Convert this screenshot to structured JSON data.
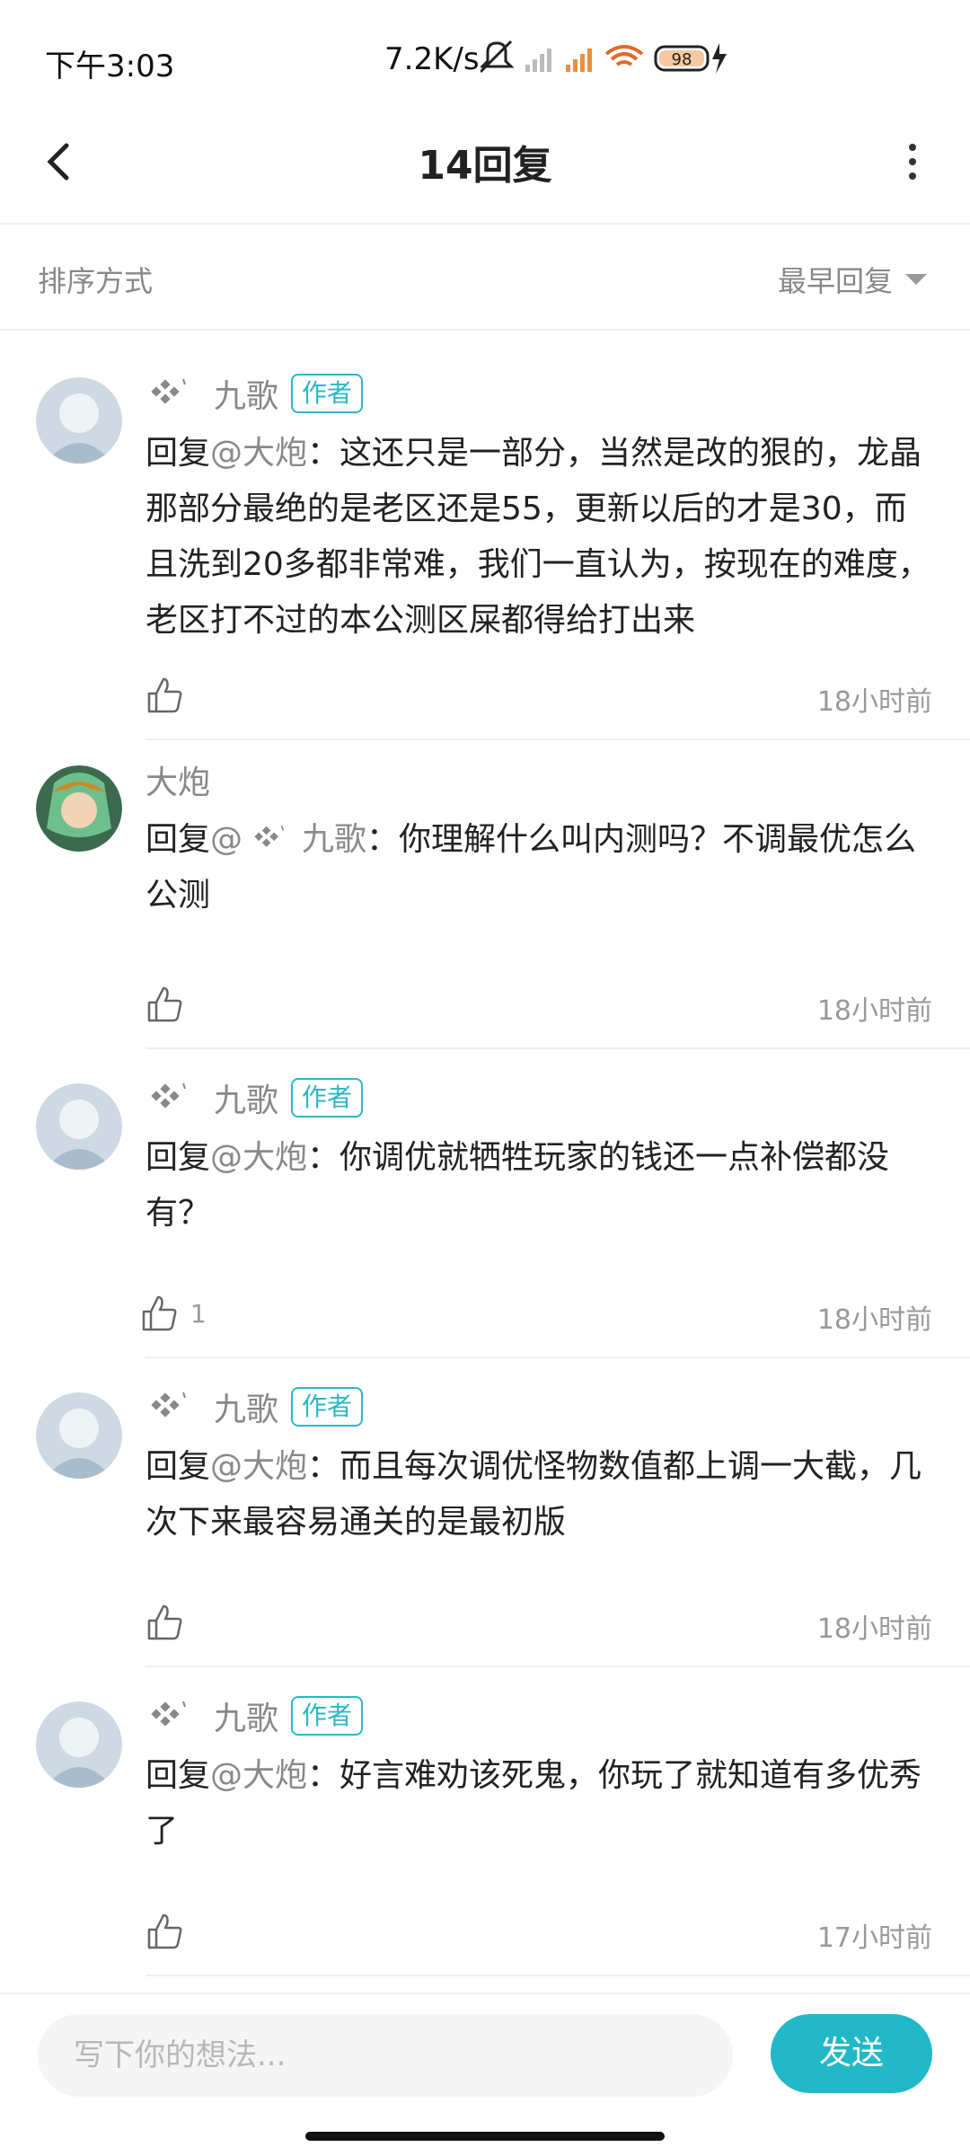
{
  "status_bar": {
    "time": "下午3:03",
    "network_speed": "7.2K/s",
    "battery": "98"
  },
  "header": {
    "title": "14回复"
  },
  "sort": {
    "label": "排序方式",
    "selected": "最早回复"
  },
  "comments": [
    {
      "author": "九歌",
      "badge": "作者",
      "reply_prefix": "回复",
      "mention": "@大炮",
      "text": "：这还只是一部分，当然是改的狠的，龙晶那部分最绝的是老区还是55，更新以后的才是30，而且洗到20多都非常难，我们一直认为，按现在的难度，老区打不过的本公测区屎都得给打出来",
      "likes": "",
      "time": "18小时前"
    },
    {
      "author": "大炮",
      "badge": "",
      "reply_prefix": "回复",
      "mention": "@",
      "mention_name": "九歌",
      "text": "：你理解什么叫内测吗？不调最优怎么公测",
      "likes": "",
      "time": "18小时前"
    },
    {
      "author": "九歌",
      "badge": "作者",
      "reply_prefix": "回复",
      "mention": "@大炮",
      "text": "：你调优就牺牲玩家的钱还一点补偿都没有？",
      "likes": "1",
      "time": "18小时前"
    },
    {
      "author": "九歌",
      "badge": "作者",
      "reply_prefix": "回复",
      "mention": "@大炮",
      "text": "：而且每次调优怪物数值都上调一大截，几次下来最容易通关的是最初版",
      "likes": "",
      "time": "18小时前"
    },
    {
      "author": "九歌",
      "badge": "作者",
      "reply_prefix": "回复",
      "mention": "@大炮",
      "text": "：好言难劝该死鬼，你玩了就知道有多优秀了",
      "likes": "",
      "time": "17小时前"
    }
  ],
  "input": {
    "placeholder": "写下你的想法...",
    "send_label": "发送"
  },
  "colors": {
    "accent": "#22b8c8",
    "badge": "#2bb7c6",
    "muted": "#999999",
    "text": "#222222"
  }
}
